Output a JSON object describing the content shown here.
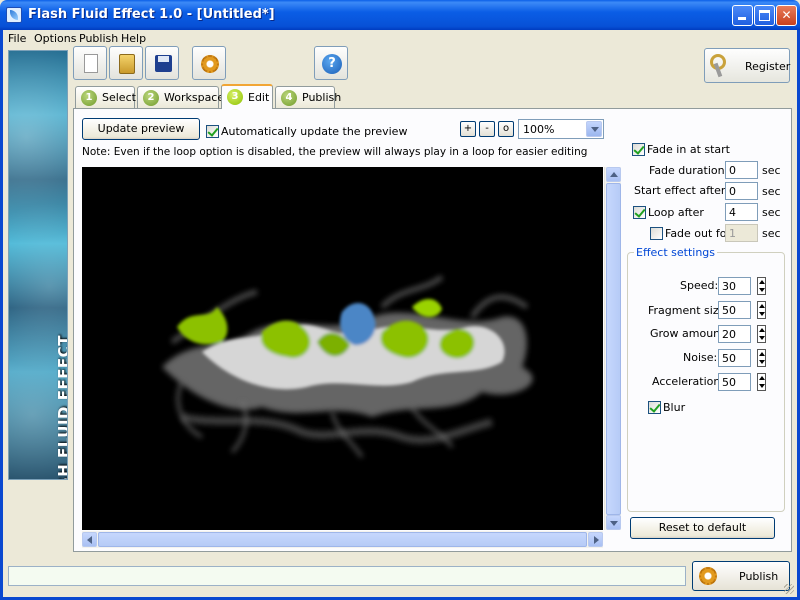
{
  "window": {
    "title": "Flash Fluid Effect 1.0 - [Untitled*]",
    "min_glyph": "",
    "max_glyph": "",
    "close_glyph": "✕"
  },
  "menu": [
    "File",
    "Options",
    "Publish",
    "Help"
  ],
  "banner": {
    "text": "FLASH FLUID EFFECT"
  },
  "toolbar": {
    "new_icon": "new-document-icon",
    "open_icon": "open-folder-icon",
    "save_icon": "save-disk-icon",
    "settings_icon": "gear-icon",
    "help_icon": "help-icon",
    "help_glyph": "?",
    "register_label": "Register"
  },
  "tabs": [
    {
      "num": "1",
      "label": "Select"
    },
    {
      "num": "2",
      "label": "Workspace"
    },
    {
      "num": "3",
      "label": "Edit",
      "active": true
    },
    {
      "num": "4",
      "label": "Publish"
    }
  ],
  "edit": {
    "update_preview_label": "Update preview",
    "auto_update_label": "Automatically update the preview",
    "auto_update_checked": true,
    "note": "Note: Even if the loop option is disabled, the preview will always play in a loop for easier editing",
    "zoom_in": "+",
    "zoom_out": "-",
    "zoom_reset": "o",
    "zoom_value": "100%"
  },
  "timing": {
    "fade_in_label": "Fade in at start",
    "fade_in_checked": true,
    "fade_duration_label": "Fade duration",
    "fade_duration_value": "0",
    "start_after_label": "Start effect after",
    "start_after_value": "0",
    "loop_after_label": "Loop after",
    "loop_after_checked": true,
    "loop_after_value": "4",
    "fade_out_label": "Fade out for",
    "fade_out_checked": false,
    "fade_out_value": "1",
    "unit": "sec"
  },
  "effect_settings": {
    "title": "Effect settings",
    "speed_label": "Speed:",
    "speed_value": "30",
    "fragment_label": "Fragment size:",
    "fragment_value": "50",
    "grow_label": "Grow amount:",
    "grow_value": "20",
    "noise_label": "Noise:",
    "noise_value": "50",
    "accel_label": "Acceleration:",
    "accel_value": "50",
    "blur_label": "Blur",
    "blur_checked": true
  },
  "reset_label": "Reset to default",
  "publish_label": "Publish",
  "colors": {
    "accent_green": "#8cc100",
    "preview_bg": "#000000",
    "title_blue": "#0b5ee6"
  }
}
